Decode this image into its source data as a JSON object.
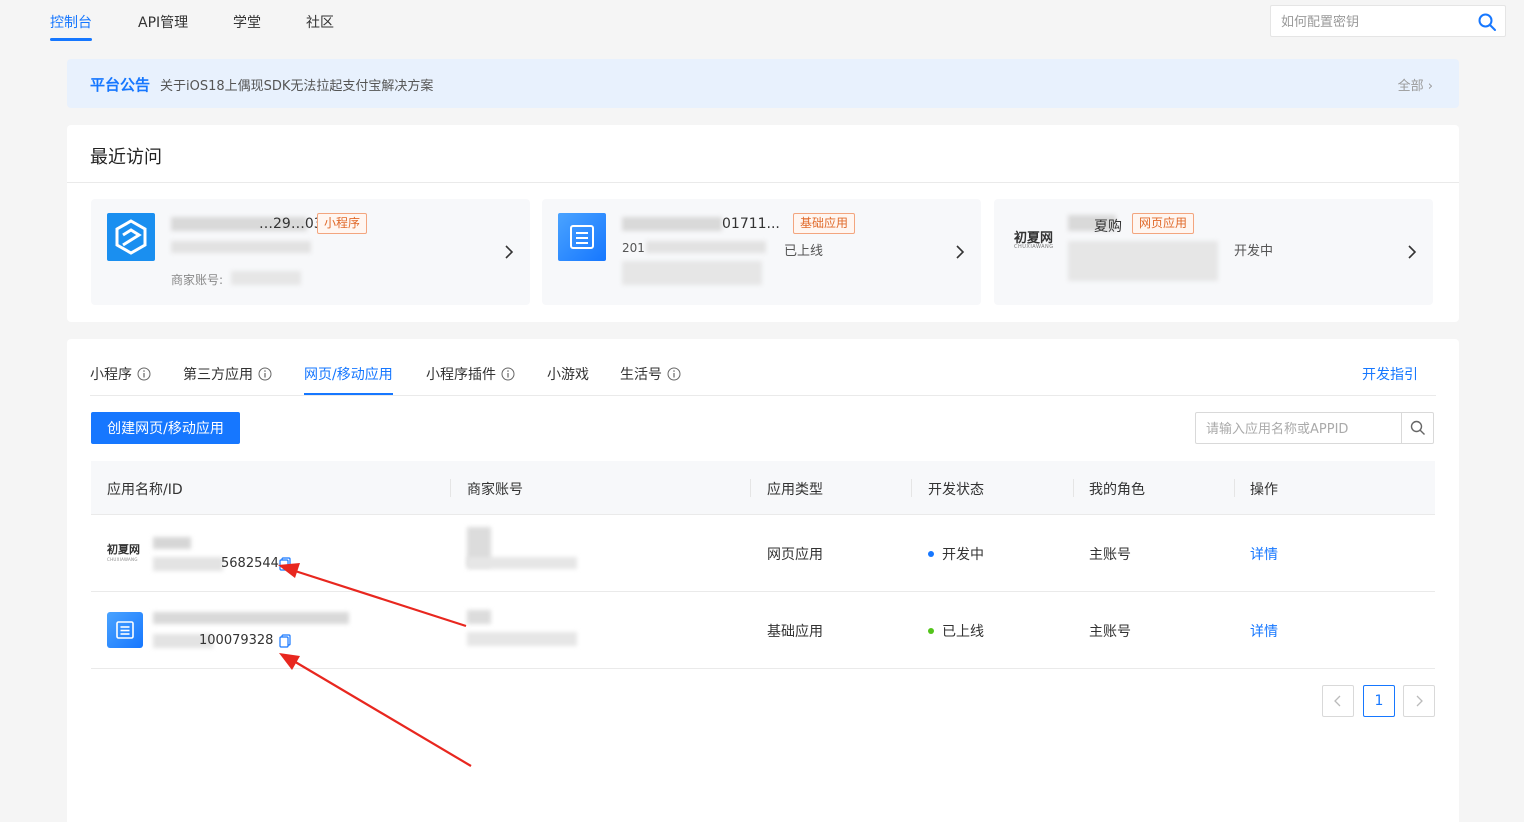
{
  "nav": {
    "tabs": [
      {
        "label": "控制台",
        "active": true
      },
      {
        "label": "API管理"
      },
      {
        "label": "学堂"
      },
      {
        "label": "社区"
      }
    ],
    "search_placeholder": "如何配置密钥"
  },
  "notice": {
    "title": "平台公告",
    "text": "关于iOS18上偶现SDK无法拉起支付宝解决方案",
    "all_label": "全部"
  },
  "recent": {
    "title": "最近访问",
    "cards": [
      {
        "name_fragment": "…29…03",
        "tag": "小程序",
        "merchant_label": "商家账号:",
        "icon": "app-logo-icon"
      },
      {
        "name_fragment": "01711...",
        "tag": "基础应用",
        "id_fragment": "201",
        "status": "已上线",
        "icon": "doc-list-icon"
      },
      {
        "name_fragment": "夏购",
        "tag": "网页应用",
        "status": "开发中",
        "logo_text": "初夏网",
        "logo_sub": "CHUXIAWANG"
      }
    ]
  },
  "main": {
    "tabs": [
      {
        "label": "小程序",
        "info": true
      },
      {
        "label": "第三方应用",
        "info": true
      },
      {
        "label": "网页/移动应用",
        "active": true
      },
      {
        "label": "小程序插件",
        "info": true
      },
      {
        "label": "小游戏"
      },
      {
        "label": "生活号",
        "info": true
      }
    ],
    "dev_guide": "开发指引",
    "create_button": "创建网页/移动应用",
    "search_placeholder": "请输入应用名称或APPID",
    "columns": [
      "应用名称/ID",
      "商家账号",
      "应用类型",
      "开发状态",
      "我的角色",
      "操作"
    ],
    "rows": [
      {
        "logo_text": "初夏网",
        "logo_sub": "CHUXIAWANG",
        "appid_suffix": "5682544",
        "type": "网页应用",
        "status": "开发中",
        "status_color": "#1677ff",
        "role": "主账号",
        "action": "详情"
      },
      {
        "logo": "doc-list-icon",
        "appid_suffix": "100079328",
        "type": "基础应用",
        "status": "已上线",
        "status_color": "#52c41a",
        "role": "主账号",
        "action": "详情"
      }
    ],
    "pagination": {
      "current": "1"
    }
  },
  "colors": {
    "accent": "#1677ff",
    "tag_orange": "#e06a2b",
    "annotation_red": "#e8271f"
  }
}
